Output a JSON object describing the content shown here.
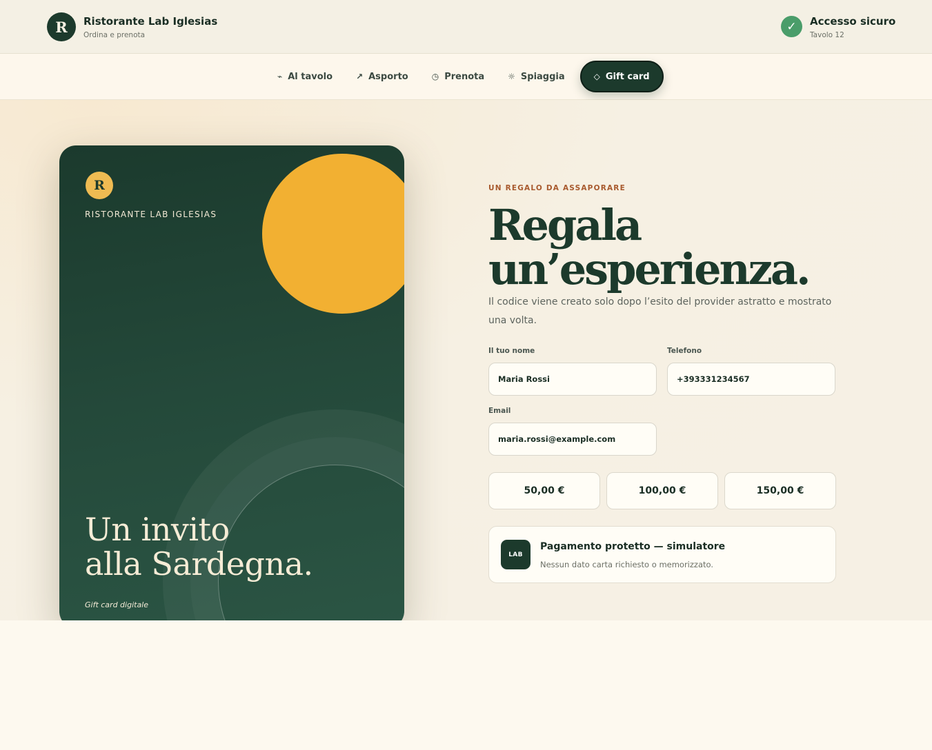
{
  "header": {
    "brand_initial": "R",
    "brand_name": "Ristorante Lab Iglesias",
    "brand_subtitle": "Ordina e prenota",
    "secure_icon": "check-icon",
    "secure_title": "Accesso sicuro",
    "secure_subtitle": "Tavolo 12"
  },
  "nav": {
    "items": [
      {
        "label": "Al tavolo",
        "icon": "⌁",
        "icon_name": "tap-icon"
      },
      {
        "label": "Asporto",
        "icon": "↗",
        "icon_name": "arrow-up-right-icon"
      },
      {
        "label": "Prenota",
        "icon": "◷",
        "icon_name": "clock-icon"
      },
      {
        "label": "Spiaggia",
        "icon": "☼",
        "icon_name": "sun-icon"
      },
      {
        "label": "Gift card",
        "icon": "◇",
        "icon_name": "diamond-icon",
        "active": true
      }
    ]
  },
  "card": {
    "logo_initial": "R",
    "brand": "RISTORANTE LAB IGLESIAS",
    "title_line1": "Un invito",
    "title_line2": "alla Sardegna.",
    "subtitle": "Gift card digitale"
  },
  "main": {
    "kicker": "UN REGALO DA ASSAPORARE",
    "headline_line1": "Regala",
    "headline_line2": "un’esperienza.",
    "lead": "Il codice viene creato solo dopo l’esito del provider astratto e mostrato una volta."
  },
  "form": {
    "name_label": "Il tuo nome",
    "name_value": "Maria Rossi",
    "phone_label": "Telefono",
    "phone_value": "+393331234567",
    "email_label": "Email",
    "email_value": "maria.rossi@example.com"
  },
  "amounts": [
    "50,00 €",
    "100,00 €",
    "150,00 €"
  ],
  "payment": {
    "badge": "LAB",
    "title": "Pagamento protetto — simulatore",
    "subtitle": "Nessun dato carta richiesto o memorizzato."
  },
  "colors": {
    "brand_green": "#1c3a2c",
    "accent_yellow": "#f2b032",
    "kicker_rust": "#a85a2e",
    "success_green": "#4a9d6a"
  }
}
